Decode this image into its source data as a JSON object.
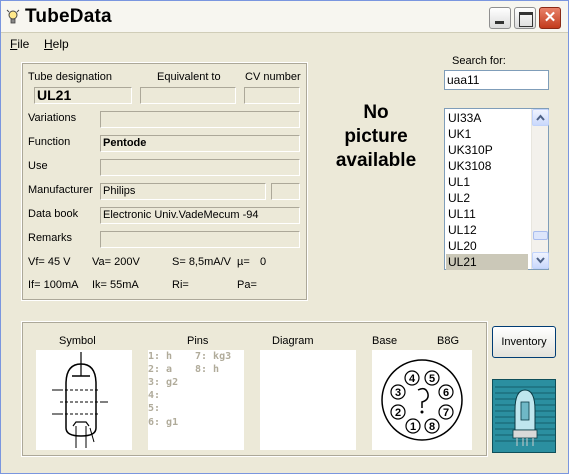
{
  "window": {
    "title": "TubeData"
  },
  "menu": {
    "file": "File",
    "file_key": "F",
    "file_rest": "ile",
    "help": "Help",
    "help_key": "H",
    "help_rest": "elp"
  },
  "labels": {
    "tube_designation": "Tube designation",
    "equivalent_to": "Equivalent to",
    "cv_number": "CV number",
    "variations": "Variations",
    "function": "Function",
    "use": "Use",
    "manufacturer": "Manufacturer",
    "data_book": "Data book",
    "remarks": "Remarks",
    "symbol": "Symbol",
    "pins": "Pins",
    "diagram": "Diagram",
    "base": "Base",
    "base_type": "B8G",
    "search_for": "Search for:"
  },
  "fields": {
    "tube_designation": "UL21",
    "equivalent_to": "",
    "cv_number": "",
    "variations": "",
    "function": "Pentode",
    "use": "",
    "manufacturer": "Philips",
    "manufacturer_code": "",
    "data_book": "Electronic Univ.VadeMecum -94",
    "remarks": ""
  },
  "specs": {
    "vf": "Vf= 45 V",
    "va": "Va= 200V",
    "s": "S= 8,5mA/V",
    "mu": "µ=",
    "mu_val": "0",
    "if": "If= 100mA",
    "ik": "Ik= 55mA",
    "ri": "Ri=",
    "pa": "Pa="
  },
  "picture": {
    "line1": "No",
    "line2": "picture",
    "line3": "available"
  },
  "search": {
    "value": "uaa11"
  },
  "tube_list": [
    "UI33A",
    "UK1",
    "UK310P",
    "UK3108",
    "UL1",
    "UL2",
    "UL11",
    "UL12",
    "UL20",
    "UL21"
  ],
  "selected_tube": "UL21",
  "pins": {
    "p1": "1: h",
    "p2": "2: a",
    "p3": "3: g2",
    "p4": "4:",
    "p5": "5:",
    "p6": "6: g1",
    "p7": "7: kg3",
    "p8": "8: h"
  },
  "base_pins": [
    "1",
    "2",
    "3",
    "4",
    "5",
    "6",
    "7",
    "8"
  ],
  "buttons": {
    "inventory": "Inventory"
  },
  "colors": {
    "window_bg": "#ece9d8",
    "close_button": "#c23b1c",
    "pin_text": "#b0ab9a",
    "logo_bg": "#1f7f8e"
  }
}
